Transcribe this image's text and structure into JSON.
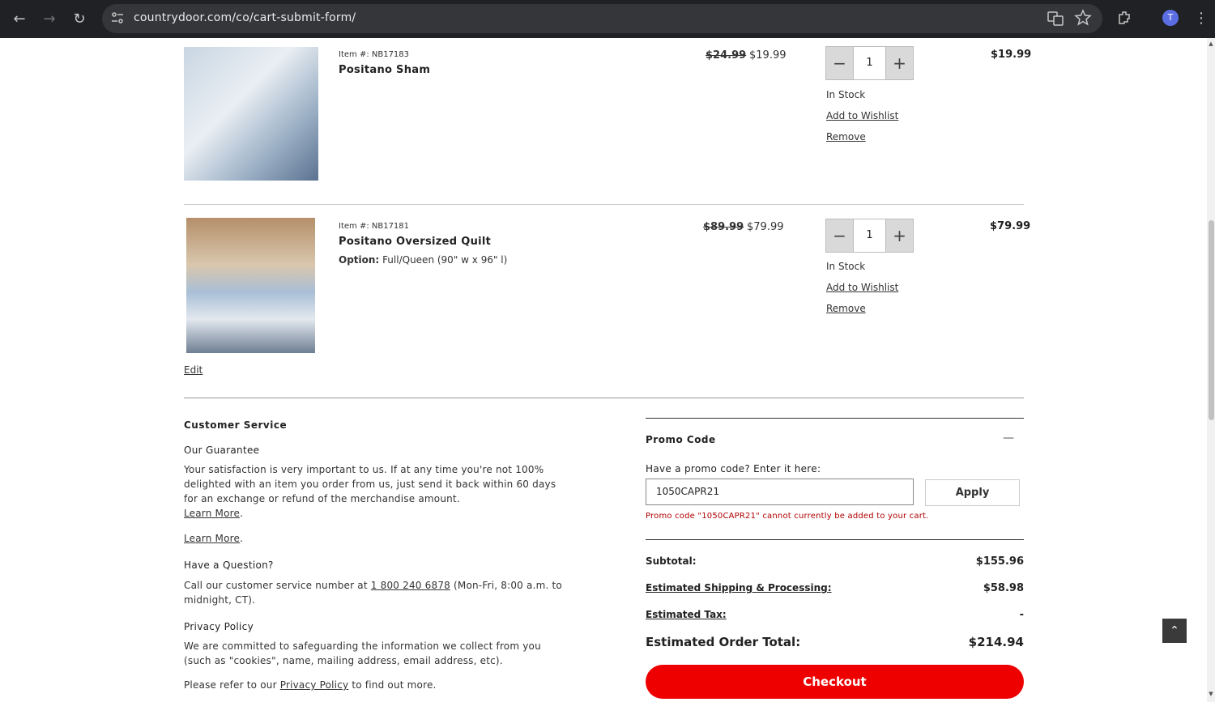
{
  "browser": {
    "url": "countrydoor.com/co/cart-submit-form/",
    "avatar_letter": "T"
  },
  "cart": {
    "items": [
      {
        "item_no": "Item #: NB17183",
        "name": "Positano Sham",
        "option_label": "",
        "option_value": "",
        "was_price": "$24.99",
        "price": "$19.99",
        "qty": "1",
        "stock": "In Stock",
        "wishlist": "Add to Wishlist",
        "remove": "Remove",
        "total": "$19.99"
      },
      {
        "item_no": "Item #: NB17181",
        "name": "Positano Oversized Quilt",
        "option_label": "Option:",
        "option_value": "Full/Queen (90\" w x 96\" l)",
        "was_price": "$89.99",
        "price": "$79.99",
        "qty": "1",
        "stock": "In Stock",
        "wishlist": "Add to Wishlist",
        "remove": "Remove",
        "total": "$79.99",
        "edit": "Edit"
      }
    ]
  },
  "customer_service": {
    "heading": "Customer Service",
    "guarantee_title": "Our Guarantee",
    "guarantee_text": "Your satisfaction is very important to us. If at any time you're not 100% delighted with an item you order from us, just send it back within 60 days for an exchange or refund of the merchandise amount.",
    "learn_more_1": "Learn More",
    "learn_more_2": "Learn More",
    "question_title": "Have a Question?",
    "question_pre": "Call our customer service number at ",
    "phone": "1 800 240 6878",
    "question_post": " (Mon-Fri, 8:00 a.m. to midnight, CT).",
    "privacy_title": "Privacy Policy",
    "privacy_text": "We are committed to safeguarding the information we collect from you (such as \"cookies\", name, mailing address, email address, etc).",
    "privacy_refer_pre": "Please refer to our ",
    "privacy_link": "Privacy Policy",
    "privacy_refer_post": " to find out more."
  },
  "promo": {
    "heading": "Promo Code",
    "collapse_symbol": "—",
    "prompt": "Have a promo code? Enter it here:",
    "code_value": "1050CAPR21",
    "apply_label": "Apply",
    "error": "Promo code \"1050CAPR21\" cannot currently be added to your cart."
  },
  "summary": {
    "subtotal_label": "Subtotal:",
    "subtotal_value": "$155.96",
    "shipping_label": "Estimated Shipping & Processing:",
    "shipping_value": "$58.98",
    "tax_label": "Estimated Tax:",
    "tax_value": "-",
    "total_label": "Estimated Order Total:",
    "total_value": "$214.94",
    "checkout_label": "Checkout"
  },
  "colors": {
    "checkout": "#ee0000",
    "error": "#b00000"
  }
}
